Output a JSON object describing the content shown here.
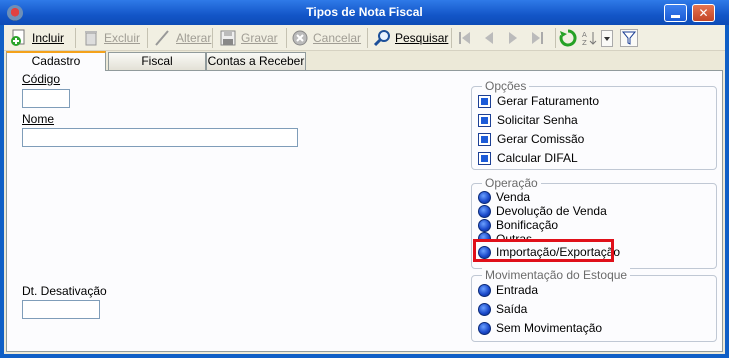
{
  "window": {
    "title": "Tipos de Nota Fiscal",
    "close_glyph": "✕"
  },
  "toolbar": {
    "incluir": {
      "label": "Incluir",
      "icon": "add-icon"
    },
    "excluir": {
      "label": "Excluir",
      "icon": "trash-icon"
    },
    "alterar": {
      "label": "Alterar",
      "icon": "pencil-icon"
    },
    "gravar": {
      "label": "Gravar",
      "icon": "save-icon"
    },
    "cancelar": {
      "label": "Cancelar",
      "icon": "cancel-icon"
    },
    "pesquisar": {
      "label": "Pesquisar",
      "icon": "search-icon"
    },
    "nav_icons": [
      "first-record-icon",
      "previous-record-icon",
      "next-record-icon",
      "last-record-icon"
    ],
    "extra_icons": [
      "refresh-icon",
      "sort-icon",
      "dropdown-arrow-icon",
      "filter-icon"
    ]
  },
  "tabs": [
    {
      "label": "Cadastro",
      "active": true
    },
    {
      "label": "Fiscal",
      "active": false
    },
    {
      "label": "Contas a Receber",
      "active": false
    }
  ],
  "form": {
    "codigo_label": "Código",
    "codigo_value": "",
    "nome_label": "Nome",
    "nome_value": "",
    "desativacao_label": "Dt. Desativação",
    "desativacao_value": ""
  },
  "opcoes": {
    "legend": "Opções",
    "items": [
      "Gerar Faturamento",
      "Solicitar Senha",
      "Gerar Comissão",
      "Calcular DIFAL"
    ]
  },
  "operacao": {
    "legend": "Operação",
    "items": [
      "Venda",
      "Devolução de Venda",
      "Bonificação",
      "Outras",
      "Importação/Exportação"
    ],
    "highlighted": "Importação/Exportação"
  },
  "movimentacao": {
    "legend": "Movimentação do Estoque",
    "items": [
      "Entrada",
      "Saída",
      "Sem Movimentação"
    ]
  },
  "colors": {
    "titlebar": "#1356c8",
    "highlight": "#e0101a",
    "tab_accent": "#f4a21b"
  }
}
